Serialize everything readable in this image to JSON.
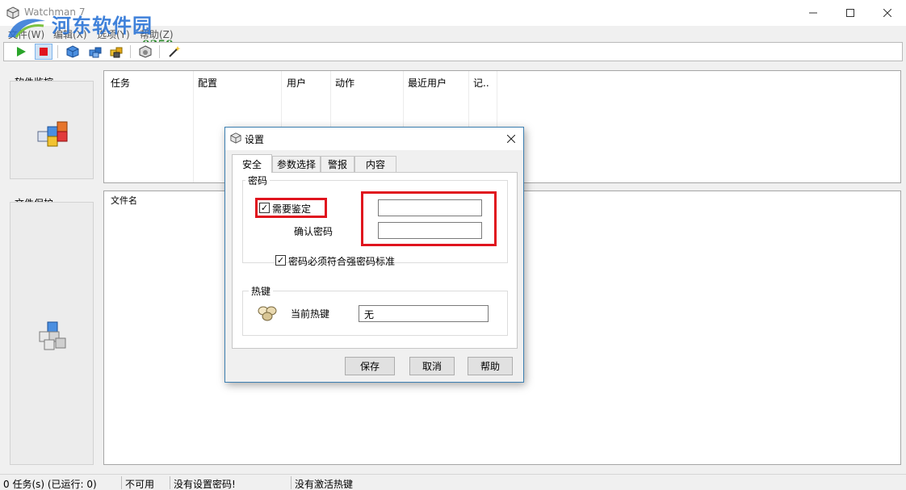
{
  "window": {
    "title": "Watchman 7"
  },
  "watermark": {
    "title": "河东软件园",
    "url": "www.pc0359.cn"
  },
  "menu": {
    "items": [
      "文件(W)",
      "编辑(X)",
      "选项(Y)",
      "帮助(Z)"
    ]
  },
  "toolbar": {
    "buttons": [
      "start-icon",
      "stop-icon",
      "blue-cube-icon",
      "blue-cubes-icon",
      "yellow-cubes-icon",
      "settings-cube-icon",
      "magic-wand-icon"
    ]
  },
  "side": {
    "monitor_label": "软件监控",
    "protect_label": "文件保护"
  },
  "tasks": {
    "columns": [
      "任务",
      "配置",
      "用户",
      "动作",
      "最近用户",
      "记.."
    ]
  },
  "files": {
    "column": "文件名"
  },
  "status": {
    "tasks": "0 任务(s) (已运行: 0)",
    "availability": "不可用",
    "password": "没有设置密码!",
    "hotkey": "没有激活热键"
  },
  "dialog": {
    "title": "设置",
    "tabs": [
      "安全",
      "参数选择",
      "警报",
      "内容"
    ],
    "active_tab": "安全",
    "password_group": "密码",
    "require_auth_label": "需要鉴定",
    "require_auth_checked": true,
    "confirm_label": "确认密码",
    "password_value": "",
    "confirm_value": "",
    "strong_label": "密码必须符合强密码标准",
    "strong_checked": true,
    "hotkey_group": "热键",
    "current_hotkey_label": "当前热键",
    "hotkey_value": "无",
    "buttons": {
      "save": "保存",
      "cancel": "取消",
      "help": "帮助"
    }
  },
  "colors": {
    "highlight": "#e0141e",
    "dialog_border": "#3c7fb1",
    "watermark_blue": "#2b74d6"
  }
}
